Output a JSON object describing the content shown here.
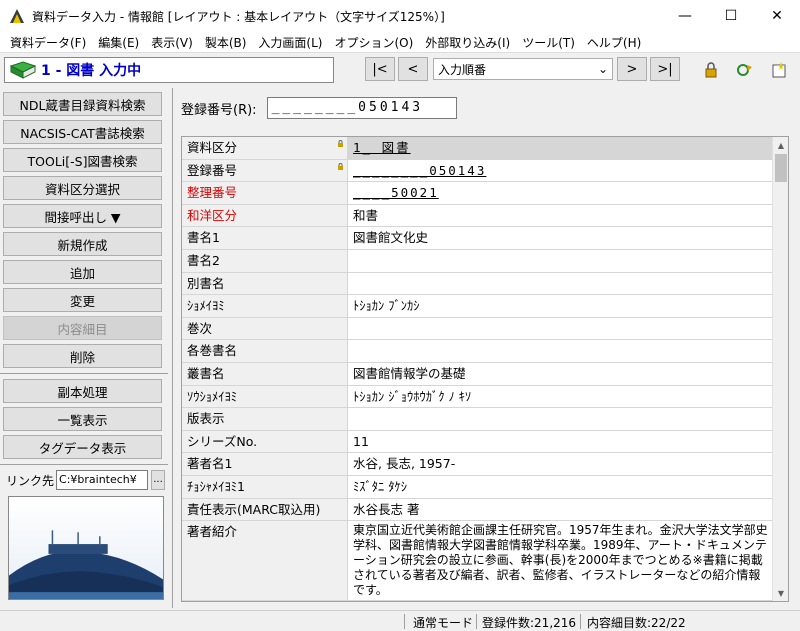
{
  "window": {
    "title": "資料データ入力 - 情報館 [レイアウト : 基本レイアウト（文字サイズ125%）]",
    "minimize": "—",
    "maximize": "☐",
    "close": "✕"
  },
  "menu": [
    "資料データ(F)",
    "編集(E)",
    "表示(V)",
    "製本(B)",
    "入力画面(L)",
    "オプション(O)",
    "外部取り込み(I)",
    "ツール(T)",
    "ヘルプ(H)"
  ],
  "status": {
    "text": "1 - 図書 入力中"
  },
  "nav": {
    "first": "|<",
    "prev": "<",
    "order": "入力順番",
    "next": ">",
    "last": ">|"
  },
  "sidebar": {
    "buttons": [
      "NDL蔵書目録資料検索",
      "NACSIS-CAT書誌検索",
      "TOOLi[-S]図書検索",
      "資料区分選択",
      "間接呼出し ▼",
      "新規作成",
      "追加",
      "変更",
      "内容細目",
      "削除"
    ],
    "buttons2": [
      "副本処理",
      "一覧表示",
      "タグデータ表示"
    ],
    "link_label": "リンク先",
    "link_value": "C:¥braintech¥",
    "link_browse": "..."
  },
  "form": {
    "regnum_label": "登録番号(R):",
    "regnum_value": "________050143"
  },
  "grid": {
    "rows": [
      {
        "label": "資料区分",
        "value": "1_ 図書",
        "lock": true,
        "red": false
      },
      {
        "label": "登録番号",
        "value": "________050143",
        "lock": true,
        "red": false
      },
      {
        "label": "整理番号",
        "value": "____50021",
        "lock": false,
        "red": true
      },
      {
        "label": "和洋区分",
        "value": "和書",
        "lock": false,
        "red": true
      },
      {
        "label": "書名1",
        "value": "図書館文化史",
        "lock": false,
        "red": false
      },
      {
        "label": "書名2",
        "value": "",
        "lock": false,
        "red": false
      },
      {
        "label": "別書名",
        "value": "",
        "lock": false,
        "red": false
      },
      {
        "label": "ｼｮﾒｲﾖﾐ",
        "value": "ﾄｼｮｶﾝ ﾌﾞﾝｶｼ",
        "lock": false,
        "red": false
      },
      {
        "label": "巻次",
        "value": "",
        "lock": false,
        "red": false
      },
      {
        "label": "各巻書名",
        "value": "",
        "lock": false,
        "red": false
      },
      {
        "label": "叢書名",
        "value": "図書館情報学の基礎",
        "lock": false,
        "red": false
      },
      {
        "label": "ｿｳｼｮﾒｲﾖﾐ",
        "value": "ﾄｼｮｶﾝ ｼﾞｮｳﾎｳｶﾞｸ ﾉ ｷｿ",
        "lock": false,
        "red": false
      },
      {
        "label": "版表示",
        "value": "",
        "lock": false,
        "red": false
      },
      {
        "label": "シリーズNo.",
        "value": "11",
        "lock": false,
        "red": false
      },
      {
        "label": "著者名1",
        "value": "水谷, 長志, 1957-",
        "lock": false,
        "red": false
      },
      {
        "label": "ﾁｮｼｬﾒｲﾖﾐ1",
        "value": "ﾐｽﾞﾀﾆ ﾀｹｼ",
        "lock": false,
        "red": false
      },
      {
        "label": "責任表示(MARC取込用)",
        "value": "水谷長志 著",
        "lock": false,
        "red": false
      },
      {
        "label": "著者紹介",
        "value": "東京国立近代美術館企画課主任研究官。1957年生まれ。金沢大学法文学部史学科、図書館情報大学図書館情報学科卒業。1989年、アート・ドキュメンテーション研究会の設立に参画、幹事(長)を2000年までつとめる※書籍に掲載されている著者及び編者、訳者、監修者、イラストレーターなどの紹介情報です。",
        "lock": false,
        "red": false
      }
    ]
  },
  "statusbar": {
    "mode": "通常モード",
    "count": "登録件数:21,216",
    "detail": "内容細目数:22/22"
  },
  "colors": {
    "status_text": "#0000c8",
    "required_label": "#e00000"
  }
}
